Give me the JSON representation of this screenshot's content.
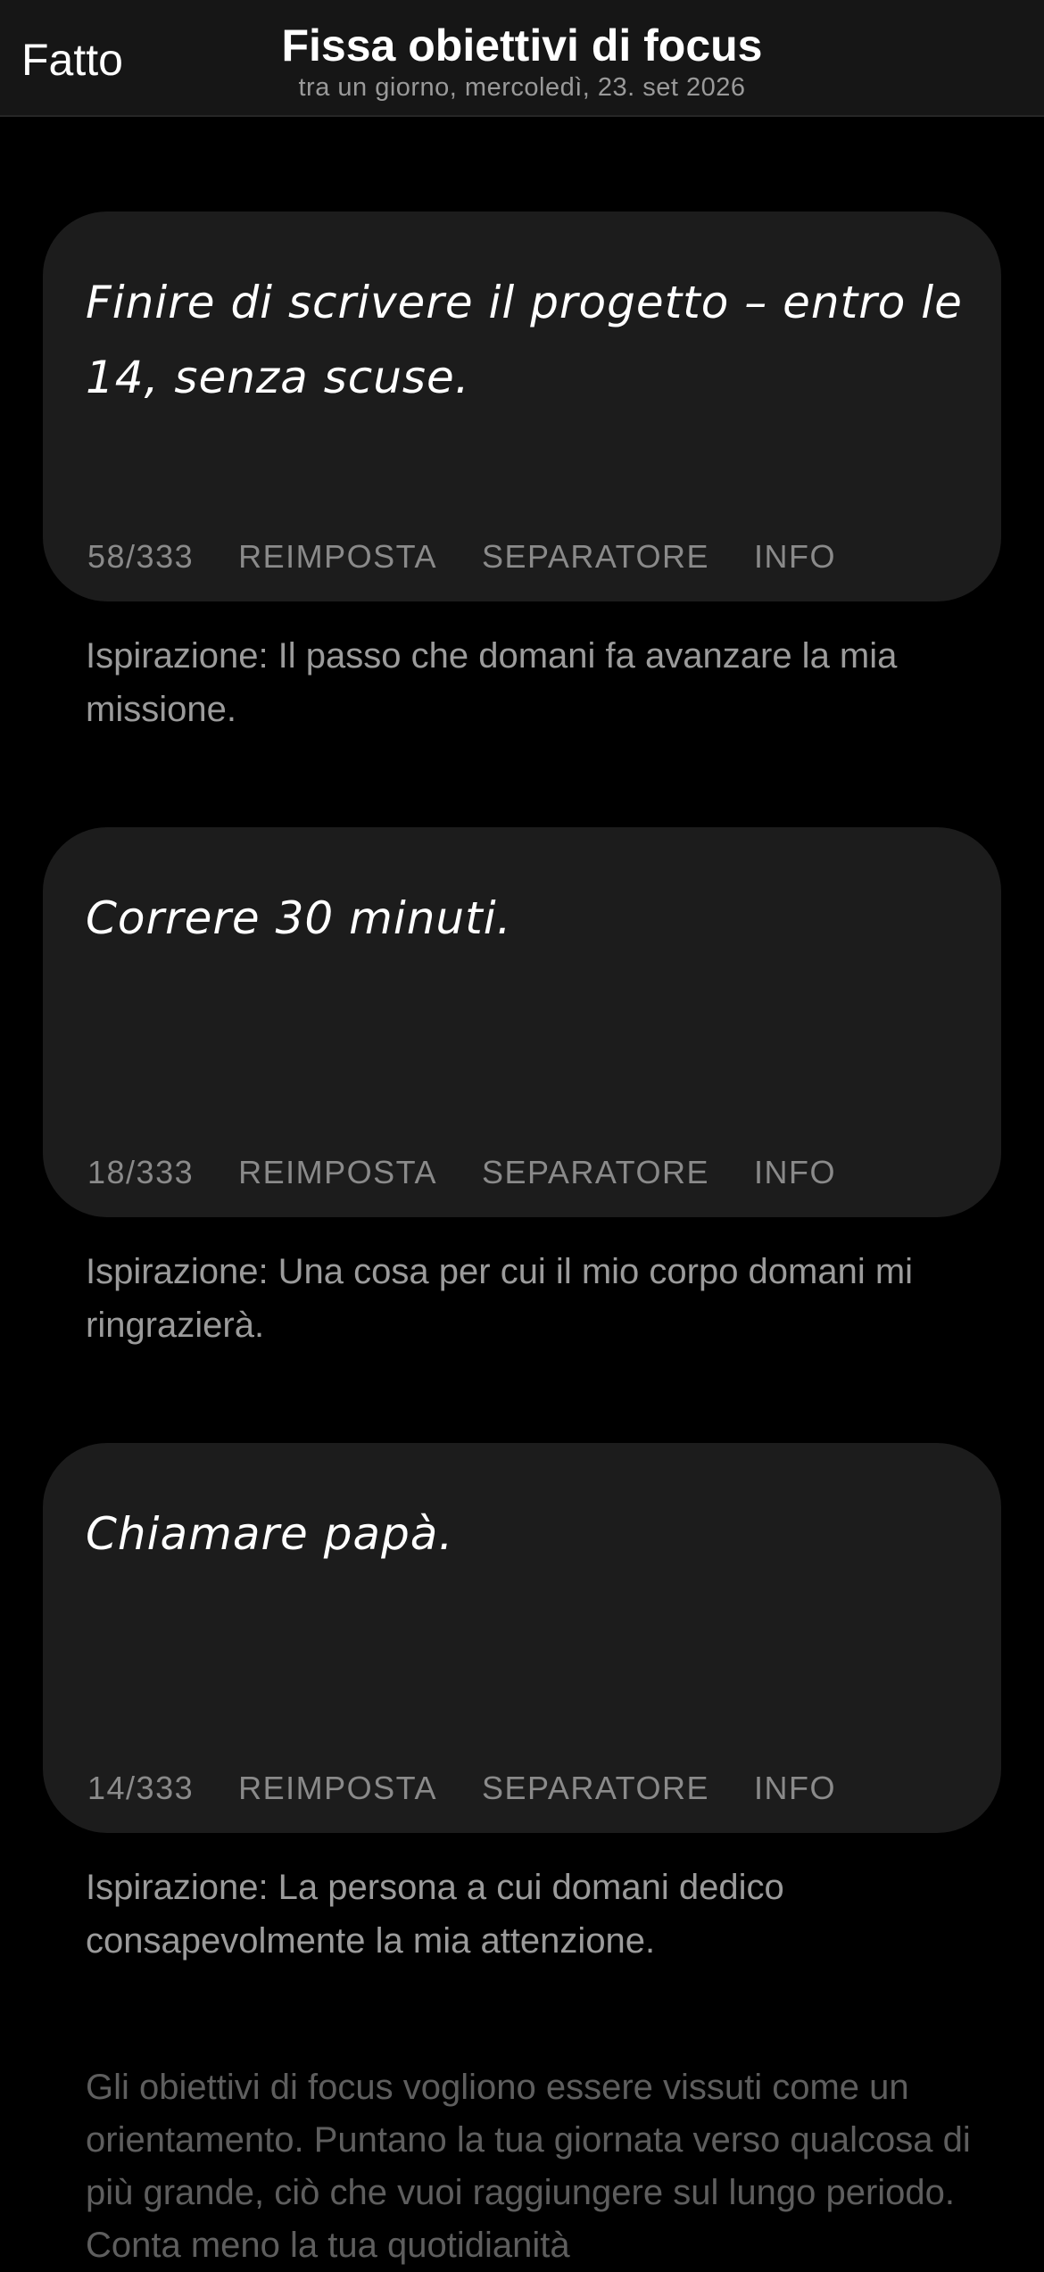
{
  "nav": {
    "done_label": "Fatto",
    "title": "Fissa obiettivi di focus",
    "subtitle": "tra un giorno, mercoledì, 23. set 2026"
  },
  "goals": [
    {
      "text": "Finire di scrivere il progetto – entro le 14, senza scuse.",
      "counter": "58/333",
      "reset_label": "REIMPOSTA",
      "separator_label": "SEPARATORE",
      "info_label": "INFO",
      "inspiration": "Ispirazione: Il passo che domani fa avanzare la mia missione."
    },
    {
      "text": "Correre 30 minuti.",
      "counter": "18/333",
      "reset_label": "REIMPOSTA",
      "separator_label": "SEPARATORE",
      "info_label": "INFO",
      "inspiration": "Ispirazione: Una cosa per cui il mio corpo domani mi ringrazierà."
    },
    {
      "text": "Chiamare papà.",
      "counter": "14/333",
      "reset_label": "REIMPOSTA",
      "separator_label": "SEPARATORE",
      "info_label": "INFO",
      "inspiration": "Ispirazione: La persona a cui domani dedico consapevolmente la mia attenzione."
    }
  ],
  "footer_text": "Gli obiettivi di focus vogliono essere vissuti come un orientamento. Puntano la tua giornata verso qualcosa di più grande, ciò che vuoi raggiungere sul lungo periodo. Conta meno la tua quotidianità",
  "colors": {
    "background": "#000000",
    "nav_background": "#161616",
    "card_background": "#1c1c1c",
    "secondary_text": "#9b9b9b",
    "footer_text": "#5e5e5e"
  }
}
